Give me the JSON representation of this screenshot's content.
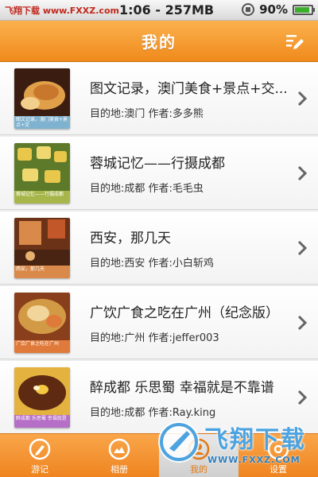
{
  "status_bar": {
    "carrier_watermark": "飞翔下载 www.FXXZ.com",
    "time_memory": "1:06 - 257MB",
    "battery": "90%"
  },
  "nav": {
    "title": "我的",
    "edit_icon": "edit-list-icon"
  },
  "travelogues": [
    {
      "title": "图文记录，澳门美食+景点+交...",
      "destination_label": "目的地:澳门",
      "author_label": "作者:多多熊",
      "thumb_caption": "图文记录，澳门美食+景点+交",
      "thumb_colors": [
        "#c9772d",
        "#3a1d10",
        "#7fb2cf"
      ]
    },
    {
      "title": "蓉城记忆——行摄成都",
      "destination_label": "目的地:成都",
      "author_label": "作者:毛毛虫",
      "thumb_caption": "蓉城记忆——行摄成都",
      "thumb_colors": [
        "#e9c74a",
        "#5d7a2a",
        "#a7b64a"
      ]
    },
    {
      "title": "西安，那几天",
      "destination_label": "目的地:西安",
      "author_label": "作者:小白斩鸡",
      "thumb_caption": "西安，那几天",
      "thumb_colors": [
        "#c2582a",
        "#6b3218",
        "#d98a4a"
      ]
    },
    {
      "title": "广饮广食之吃在广州（纪念版）",
      "destination_label": "目的地:广州",
      "author_label": "作者:jeffer003",
      "thumb_caption": "广饮广食之吃在广州",
      "thumb_colors": [
        "#d29a45",
        "#8a3f1c",
        "#e07a3a"
      ]
    },
    {
      "title": "醉成都 乐思蜀 幸福就是不靠谱",
      "destination_label": "目的地:成都",
      "author_label": "作者:Ray.king",
      "thumb_caption": "醉成都 乐思蜀 幸福就是",
      "thumb_colors": [
        "#e4b33f",
        "#5e2a12",
        "#b66fc7"
      ]
    }
  ],
  "tabs": [
    {
      "label": "游记",
      "icon": "pencil-icon",
      "active": false
    },
    {
      "label": "相册",
      "icon": "photo-icon",
      "active": false
    },
    {
      "label": "我的",
      "icon": "person-icon",
      "active": true
    },
    {
      "label": "设置",
      "icon": "gear-icon",
      "active": false
    }
  ],
  "watermark": {
    "text": "飞翔下载",
    "url": "WWW.FXXZ.COM"
  },
  "colors": {
    "nav_orange": "#f08a1c",
    "tab_orange": "#ef8420",
    "active_tab_text": "#e27a14"
  }
}
